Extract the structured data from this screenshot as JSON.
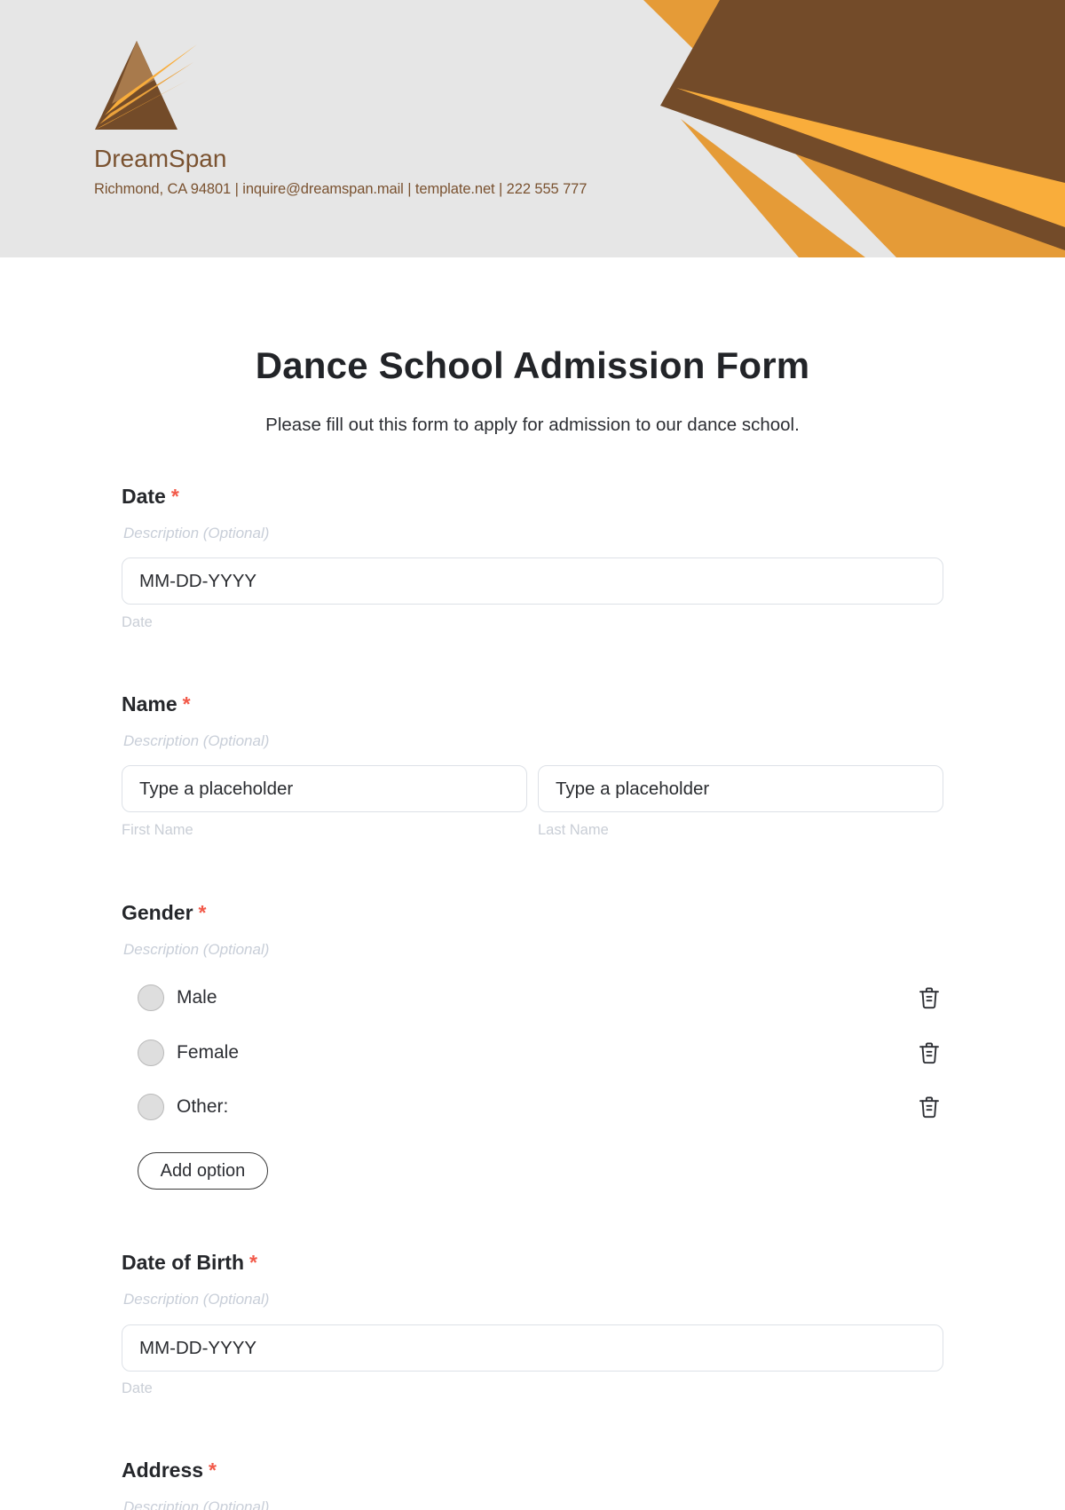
{
  "brand": {
    "name": "DreamSpan",
    "contact": "Richmond, CA 94801 | inquire@dreamspan.mail | template.net | 222 555 777",
    "colors": {
      "brown": "#734b29",
      "yellow": "#f9ad3b",
      "orange": "#e59b37",
      "header_bg": "#e6e6e6",
      "text_brand": "#7a5230",
      "required": "#f25a4a"
    }
  },
  "form": {
    "title": "Dance School Admission Form",
    "subtitle": "Please fill out this form to apply for admission to our dance school.",
    "required_marker": "*",
    "fields": {
      "date": {
        "label": "Date",
        "description_placeholder": "Description (Optional)",
        "input_placeholder": "MM-DD-YYYY",
        "helper": "Date"
      },
      "name": {
        "label": "Name",
        "description_placeholder": "Description (Optional)",
        "first": {
          "input_placeholder": "Type a placeholder",
          "helper": "First Name"
        },
        "last": {
          "input_placeholder": "Type a placeholder",
          "helper": "Last Name"
        }
      },
      "gender": {
        "label": "Gender",
        "description_placeholder": "Description (Optional)",
        "options": [
          {
            "label": "Male",
            "selected": false,
            "delete_icon": "trash-icon"
          },
          {
            "label": "Female",
            "selected": false,
            "delete_icon": "trash-icon"
          },
          {
            "label": "Other:",
            "selected": false,
            "delete_icon": "trash-icon"
          }
        ],
        "add_option_label": "Add option"
      },
      "dob": {
        "label": "Date of Birth",
        "description_placeholder": "Description (Optional)",
        "input_placeholder": "MM-DD-YYYY",
        "helper": "Date"
      },
      "address": {
        "label": "Address",
        "description_placeholder": "Description (Optional)"
      }
    }
  }
}
